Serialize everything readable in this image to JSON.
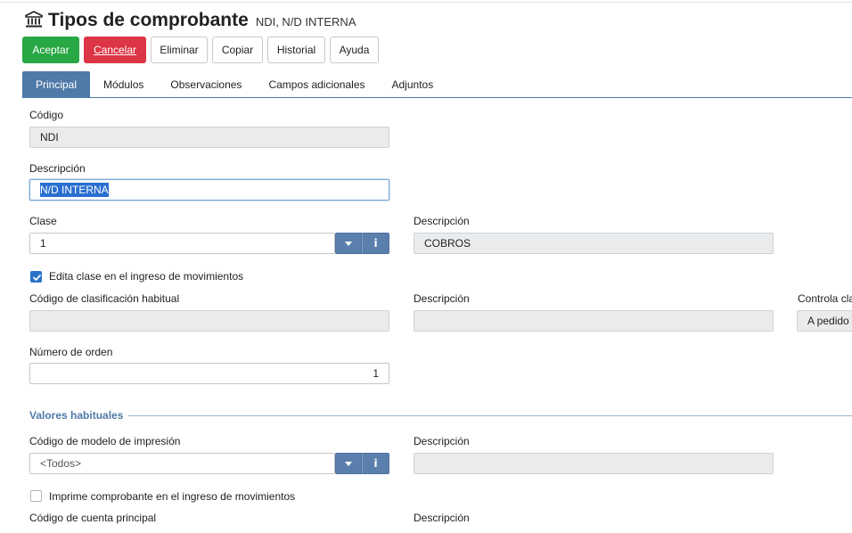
{
  "header": {
    "title": "Tipos de comprobante",
    "subtitle": "NDI, N/D INTERNA",
    "icon": "bank-icon"
  },
  "toolbar": {
    "aceptar": "Aceptar",
    "cancelar": "Cancelar",
    "eliminar": "Eliminar",
    "copiar": "Copiar",
    "historial": "Historial",
    "ayuda": "Ayuda"
  },
  "tabs": [
    {
      "label": "Principal",
      "active": true
    },
    {
      "label": "Módulos"
    },
    {
      "label": "Observaciones"
    },
    {
      "label": "Campos adicionales"
    },
    {
      "label": "Adjuntos"
    }
  ],
  "form": {
    "codigo": {
      "label": "Código",
      "value": "NDI"
    },
    "descripcion": {
      "label": "Descripción",
      "value": "N/D INTERNA"
    },
    "clase": {
      "label": "Clase",
      "value": "1"
    },
    "clase_descripcion": {
      "label": "Descripción",
      "value": "COBROS"
    },
    "edita_clase": {
      "label": "Edita clase en el ingreso de movimientos",
      "checked": true
    },
    "cod_clasificacion": {
      "label": "Código de clasificación habitual",
      "value": ""
    },
    "clasificacion_descripcion": {
      "label": "Descripción",
      "value": ""
    },
    "controla_clasificacion": {
      "label": "Controla cla",
      "value": "A pedido"
    },
    "numero_orden": {
      "label": "Número de orden",
      "value": "1"
    }
  },
  "valores_habituales": {
    "title": "Valores habituales",
    "modelo_impresion": {
      "label": "Código de modelo de impresión",
      "value": "<Todos>"
    },
    "modelo_descripcion": {
      "label": "Descripción",
      "value": ""
    },
    "imprime_comprobante": {
      "label": "Imprime comprobante en el ingreso de movimientos",
      "checked": false
    },
    "cuenta_principal": {
      "label": "Código de cuenta principal"
    },
    "cuenta_descripcion": {
      "label": "Descripción"
    }
  },
  "colors": {
    "primary": "#28a745",
    "danger": "#dc3545",
    "accent": "#4f7aa8",
    "checkbox": "#2a73c9"
  }
}
